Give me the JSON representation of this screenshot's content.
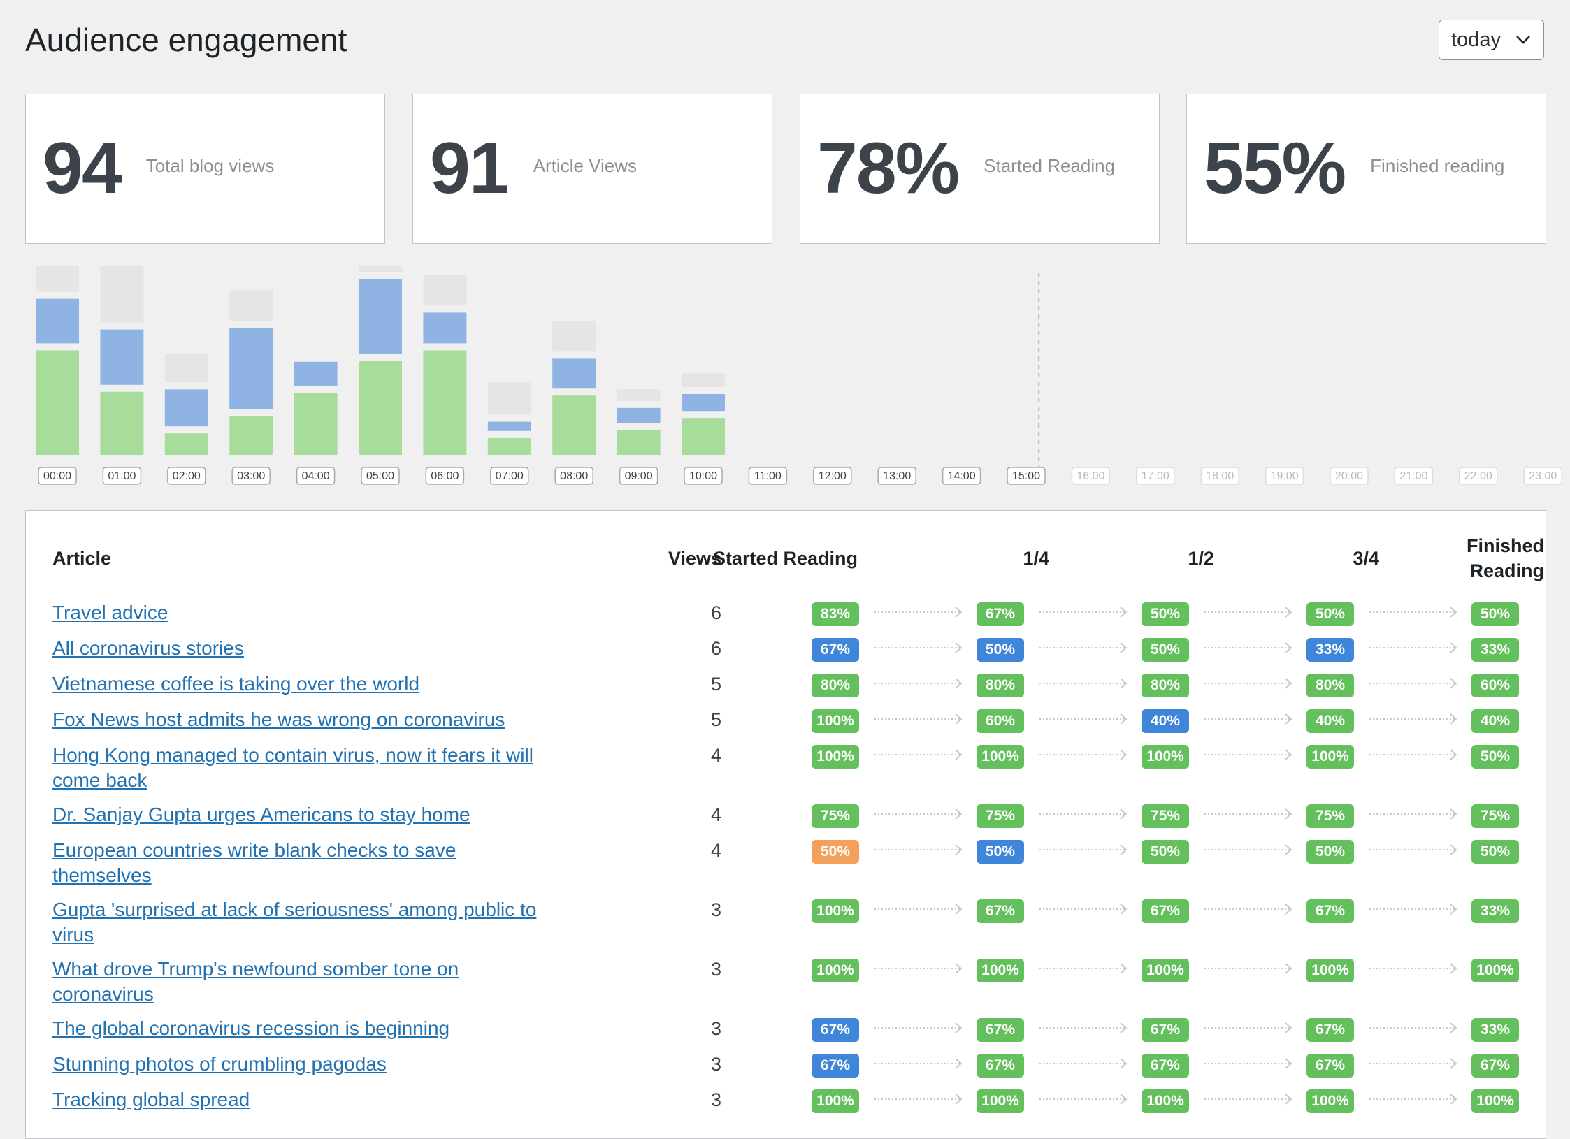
{
  "page_title": "Audience engagement",
  "range_select": {
    "value": "today"
  },
  "stats": [
    {
      "value": "94",
      "label": "Total blog views"
    },
    {
      "value": "91",
      "label": "Article Views"
    },
    {
      "value": "78%",
      "label": "Started Reading"
    },
    {
      "value": "55%",
      "label": "Finished reading"
    }
  ],
  "colors": {
    "finished": "#a8dc9b",
    "started": "#8fb3e3",
    "views": "#e5e5e5",
    "badge_green": "#63c05c",
    "badge_blue": "#3f86da",
    "badge_orange": "#f3a05c",
    "link": "#2271b1"
  },
  "chart_data": {
    "type": "bar",
    "stacked": true,
    "categories": [
      "00:00",
      "01:00",
      "02:00",
      "03:00",
      "04:00",
      "05:00",
      "06:00",
      "07:00",
      "08:00",
      "09:00",
      "10:00",
      "11:00",
      "12:00",
      "13:00",
      "14:00",
      "15:00",
      "16:00",
      "17:00",
      "18:00",
      "19:00",
      "20:00",
      "21:00",
      "22:00",
      "23:00"
    ],
    "current_hour_index": 15,
    "series": [
      {
        "key": "finished",
        "values": [
          6.8,
          4.1,
          1.4,
          2.5,
          4.0,
          6.1,
          6.8,
          1.1,
          3.9,
          1.6,
          2.4,
          0,
          0,
          0,
          0,
          0,
          0,
          0,
          0,
          0,
          0,
          0,
          0,
          0
        ]
      },
      {
        "key": "started",
        "values": [
          2.9,
          3.6,
          2.4,
          5.3,
          1.6,
          4.9,
          2.0,
          0.6,
          1.9,
          1.0,
          1.1,
          0,
          0,
          0,
          0,
          0,
          0,
          0,
          0,
          0,
          0,
          0,
          0,
          0
        ]
      },
      {
        "key": "views",
        "values": [
          2.2,
          4.0,
          1.9,
          2.0,
          0,
          2.1,
          2.0,
          2.1,
          2.0,
          0.8,
          0.9,
          0,
          0,
          0,
          0,
          0,
          0,
          0,
          0,
          0,
          0,
          0,
          0,
          0
        ]
      }
    ]
  },
  "table": {
    "headers": {
      "article": "Article",
      "views": "Views",
      "started": "Started Reading",
      "q1": "1/4",
      "q2": "1/2",
      "q3": "3/4",
      "finished_line1": "Finished",
      "finished_line2": "Reading"
    },
    "rows": [
      {
        "title_lines": [
          "Travel advice"
        ],
        "views": "6",
        "cells": [
          [
            "83%",
            "g"
          ],
          [
            "67%",
            "g"
          ],
          [
            "50%",
            "g"
          ],
          [
            "50%",
            "g"
          ],
          [
            "50%",
            "g"
          ]
        ]
      },
      {
        "title_lines": [
          "All coronavirus stories"
        ],
        "views": "6",
        "cells": [
          [
            "67%",
            "b"
          ],
          [
            "50%",
            "b"
          ],
          [
            "50%",
            "g"
          ],
          [
            "33%",
            "b"
          ],
          [
            "33%",
            "g"
          ]
        ]
      },
      {
        "title_lines": [
          "Vietnamese coffee is taking over the world"
        ],
        "views": "5",
        "cells": [
          [
            "80%",
            "g"
          ],
          [
            "80%",
            "g"
          ],
          [
            "80%",
            "g"
          ],
          [
            "80%",
            "g"
          ],
          [
            "60%",
            "g"
          ]
        ]
      },
      {
        "title_lines": [
          "Fox News host admits he was wrong on coronavirus"
        ],
        "views": "5",
        "cells": [
          [
            "100%",
            "g"
          ],
          [
            "60%",
            "g"
          ],
          [
            "40%",
            "b"
          ],
          [
            "40%",
            "g"
          ],
          [
            "40%",
            "g"
          ]
        ]
      },
      {
        "title_lines": [
          "Hong Kong managed to contain virus, now it fears it will",
          "come back"
        ],
        "views": "4",
        "cells": [
          [
            "100%",
            "g"
          ],
          [
            "100%",
            "g"
          ],
          [
            "100%",
            "g"
          ],
          [
            "100%",
            "g"
          ],
          [
            "50%",
            "g"
          ]
        ]
      },
      {
        "title_lines": [
          "Dr. Sanjay Gupta urges Americans to stay home"
        ],
        "views": "4",
        "cells": [
          [
            "75%",
            "g"
          ],
          [
            "75%",
            "g"
          ],
          [
            "75%",
            "g"
          ],
          [
            "75%",
            "g"
          ],
          [
            "75%",
            "g"
          ]
        ]
      },
      {
        "title_lines": [
          "European countries write blank checks to save",
          "themselves"
        ],
        "views": "4",
        "cells": [
          [
            "50%",
            "o"
          ],
          [
            "50%",
            "b"
          ],
          [
            "50%",
            "g"
          ],
          [
            "50%",
            "g"
          ],
          [
            "50%",
            "g"
          ]
        ]
      },
      {
        "title_lines": [
          "Gupta 'surprised at lack of seriousness' among public to",
          "virus"
        ],
        "views": "3",
        "cells": [
          [
            "100%",
            "g"
          ],
          [
            "67%",
            "g"
          ],
          [
            "67%",
            "g"
          ],
          [
            "67%",
            "g"
          ],
          [
            "33%",
            "g"
          ]
        ]
      },
      {
        "title_lines": [
          "What drove Trump's newfound somber tone on",
          "coronavirus"
        ],
        "views": "3",
        "cells": [
          [
            "100%",
            "g"
          ],
          [
            "100%",
            "g"
          ],
          [
            "100%",
            "g"
          ],
          [
            "100%",
            "g"
          ],
          [
            "100%",
            "g"
          ]
        ]
      },
      {
        "title_lines": [
          "The global coronavirus recession is beginning"
        ],
        "views": "3",
        "cells": [
          [
            "67%",
            "b"
          ],
          [
            "67%",
            "g"
          ],
          [
            "67%",
            "g"
          ],
          [
            "67%",
            "g"
          ],
          [
            "33%",
            "g"
          ]
        ]
      },
      {
        "title_lines": [
          "Stunning photos of crumbling pagodas"
        ],
        "views": "3",
        "cells": [
          [
            "67%",
            "b"
          ],
          [
            "67%",
            "g"
          ],
          [
            "67%",
            "g"
          ],
          [
            "67%",
            "g"
          ],
          [
            "67%",
            "g"
          ]
        ]
      },
      {
        "title_lines": [
          "Tracking global spread"
        ],
        "views": "3",
        "cells": [
          [
            "100%",
            "g"
          ],
          [
            "100%",
            "g"
          ],
          [
            "100%",
            "g"
          ],
          [
            "100%",
            "g"
          ],
          [
            "100%",
            "g"
          ]
        ]
      }
    ]
  }
}
